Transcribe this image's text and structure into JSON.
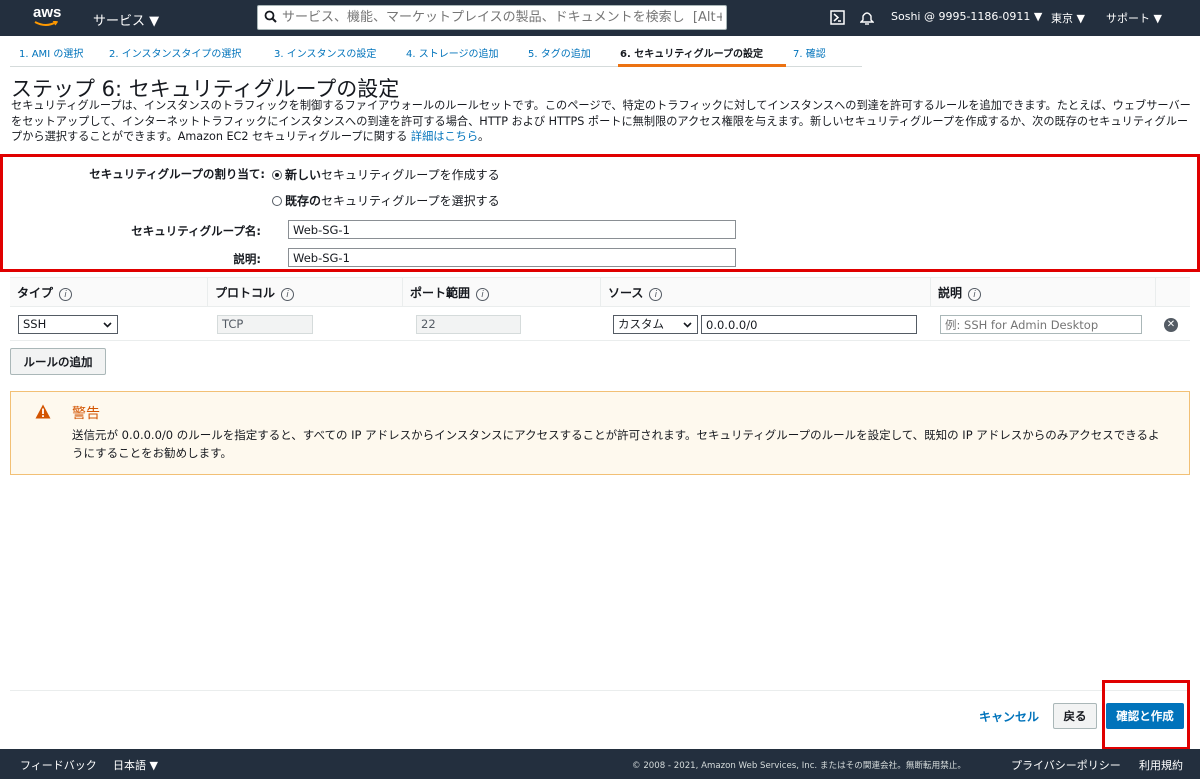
{
  "nav": {
    "logo": "aws",
    "services": "サービス ▼",
    "search_placeholder": "サービス、機能、マーケットプレイスの製品、ドキュメントを検索し  [Alt+S]",
    "account": "Soshi @ 9995-1186-0911 ▼",
    "region": "東京 ▼",
    "support": "サポート ▼"
  },
  "steps": [
    "1. AMI の選択",
    "2. インスタンスタイプの選択",
    "3. インスタンスの設定",
    "4. ストレージの追加",
    "5. タグの追加",
    "6. セキュリティグループの設定",
    "7. 確認"
  ],
  "page": {
    "title": "ステップ 6: セキュリティグループの設定",
    "description": "セキュリティグループは、インスタンスのトラフィックを制御するファイアウォールのルールセットです。このページで、特定のトラフィックに対してインスタンスへの到達を許可するルールを追加できます。たとえば、ウェブサーバーをセットアップして、インターネットトラフィックにインスタンスへの到達を許可する場合、HTTP および HTTPS ポートに無制限のアクセス権限を与えます。新しいセキュリティグループを作成するか、次の既存のセキュリティグループから選択することができます。Amazon EC2 セキュリティグループに関する",
    "details_link": "詳細はこちら",
    "details_after": "。"
  },
  "form": {
    "assign_label": "セキュリティグループの割り当て:",
    "option_new_bold": "新しい",
    "option_new_rest": "セキュリティグループを作成する",
    "option_existing_bold": "既存の",
    "option_existing_rest": "セキュリティグループを選択する",
    "name_label": "セキュリティグループ名:",
    "name_value": "Web-SG-1",
    "desc_label": "説明:",
    "desc_value": "Web-SG-1"
  },
  "table": {
    "headers": [
      "タイプ",
      "プロトコル",
      "ポート範囲",
      "ソース",
      "説明"
    ],
    "info_glyph": "i",
    "row": {
      "type": "SSH",
      "protocol": "TCP",
      "port": "22",
      "source_type": "カスタム",
      "source_cidr": "0.0.0.0/0",
      "desc_placeholder": "例: SSH for Admin Desktop"
    },
    "delete_glyph": "✕"
  },
  "add_rule": "ルールの追加",
  "warning": {
    "title": "警告",
    "text": "送信元が 0.0.0.0/0 のルールを指定すると、すべての IP アドレスからインスタンスにアクセスすることが許可されます。セキュリティグループのルールを設定して、既知の IP アドレスからのみアクセスできるようにすることをお勧めします。",
    "color": "#d35400"
  },
  "actions": {
    "cancel": "キャンセル",
    "back": "戻る",
    "review_create": "確認と作成",
    "primary_color": "#0073bb"
  },
  "footer": {
    "feedback": "フィードバック",
    "language": "日本語 ▼",
    "copyright": "© 2008 - 2021, Amazon Web Services, Inc. またはその関連会社。無断転用禁止。",
    "privacy": "プライバシーポリシー",
    "terms": "利用規約"
  }
}
